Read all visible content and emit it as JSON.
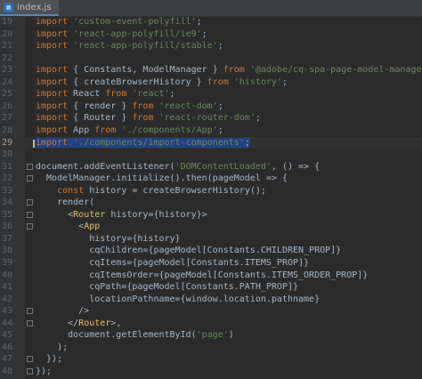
{
  "tab": {
    "filename": "index.js",
    "icon": "js-file-icon"
  },
  "colors": {
    "background": "#2b2b2b",
    "keyword": "#cc7832",
    "string": "#6a8759",
    "tag": "#e8bf6a",
    "text": "#a9b7c6",
    "selection": "#214283"
  },
  "lines": [
    {
      "num": "19",
      "tokens": [
        {
          "t": "import ",
          "c": "kw"
        },
        {
          "t": "'custom-event-polyfill'",
          "c": "str"
        },
        {
          "t": ";",
          "c": "plain"
        }
      ]
    },
    {
      "num": "20",
      "tokens": [
        {
          "t": "import ",
          "c": "kw"
        },
        {
          "t": "'react-app-polyfill/ie9'",
          "c": "str"
        },
        {
          "t": ";",
          "c": "plain"
        }
      ]
    },
    {
      "num": "21",
      "tokens": [
        {
          "t": "import ",
          "c": "kw"
        },
        {
          "t": "'react-app-polyfill/stable'",
          "c": "str"
        },
        {
          "t": ";",
          "c": "plain"
        }
      ]
    },
    {
      "num": "22",
      "tokens": []
    },
    {
      "num": "23",
      "tokens": [
        {
          "t": "import ",
          "c": "kw"
        },
        {
          "t": "{ Constants, ModelManager } ",
          "c": "plain"
        },
        {
          "t": "from ",
          "c": "kw"
        },
        {
          "t": "'@adobe/cq-spa-page-model-manager'",
          "c": "str"
        },
        {
          "t": ";",
          "c": "plain"
        }
      ]
    },
    {
      "num": "24",
      "tokens": [
        {
          "t": "import ",
          "c": "kw"
        },
        {
          "t": "{ createBrowserHistory } ",
          "c": "plain"
        },
        {
          "t": "from ",
          "c": "kw"
        },
        {
          "t": "'history'",
          "c": "str"
        },
        {
          "t": ";",
          "c": "plain"
        }
      ]
    },
    {
      "num": "25",
      "tokens": [
        {
          "t": "import ",
          "c": "kw"
        },
        {
          "t": "React ",
          "c": "plain"
        },
        {
          "t": "from ",
          "c": "kw"
        },
        {
          "t": "'react'",
          "c": "str"
        },
        {
          "t": ";",
          "c": "plain"
        }
      ]
    },
    {
      "num": "26",
      "tokens": [
        {
          "t": "import ",
          "c": "kw"
        },
        {
          "t": "{ render } ",
          "c": "plain"
        },
        {
          "t": "from ",
          "c": "kw"
        },
        {
          "t": "'react-dom'",
          "c": "str"
        },
        {
          "t": ";",
          "c": "plain"
        }
      ]
    },
    {
      "num": "27",
      "tokens": [
        {
          "t": "import ",
          "c": "kw"
        },
        {
          "t": "{ Router } ",
          "c": "plain"
        },
        {
          "t": "from ",
          "c": "kw"
        },
        {
          "t": "'react-router-dom'",
          "c": "str"
        },
        {
          "t": ";",
          "c": "plain"
        }
      ]
    },
    {
      "num": "28",
      "tokens": [
        {
          "t": "import ",
          "c": "kw"
        },
        {
          "t": "App ",
          "c": "plain"
        },
        {
          "t": "from ",
          "c": "kw"
        },
        {
          "t": "'./components/App'",
          "c": "str"
        },
        {
          "t": ";",
          "c": "plain"
        }
      ]
    },
    {
      "num": "29",
      "current": true,
      "tokens": [
        {
          "t": "import ",
          "c": "kw",
          "sel": true
        },
        {
          "t": "'./components/import-components'",
          "c": "str",
          "sel": true
        },
        {
          "t": ";",
          "c": "plain",
          "sel": true
        }
      ]
    },
    {
      "num": "30",
      "tokens": []
    },
    {
      "num": "31",
      "tokens": [
        {
          "t": "document.addEventListener(",
          "c": "plain"
        },
        {
          "t": "'DOMContentLoaded'",
          "c": "str"
        },
        {
          "t": ", () => {",
          "c": "plain"
        }
      ]
    },
    {
      "num": "32",
      "tokens": [
        {
          "t": "  ModelManager.initialize().then(pageModel => {",
          "c": "plain"
        }
      ]
    },
    {
      "num": "33",
      "tokens": [
        {
          "t": "    ",
          "c": "plain"
        },
        {
          "t": "const ",
          "c": "kw"
        },
        {
          "t": "history = createBrowserHistory();",
          "c": "plain"
        }
      ]
    },
    {
      "num": "34",
      "tokens": [
        {
          "t": "    render(",
          "c": "plain"
        }
      ]
    },
    {
      "num": "35",
      "tokens": [
        {
          "t": "      <",
          "c": "plain"
        },
        {
          "t": "Router ",
          "c": "tag"
        },
        {
          "t": "history={history}>",
          "c": "plain"
        }
      ]
    },
    {
      "num": "36",
      "tokens": [
        {
          "t": "        <",
          "c": "plain"
        },
        {
          "t": "App",
          "c": "tag"
        }
      ]
    },
    {
      "num": "37",
      "tokens": [
        {
          "t": "          history={history}",
          "c": "plain"
        }
      ]
    },
    {
      "num": "38",
      "tokens": [
        {
          "t": "          cqChildren={pageModel[Constants.CHILDREN_PROP]}",
          "c": "plain"
        }
      ]
    },
    {
      "num": "39",
      "tokens": [
        {
          "t": "          cqItems={pageModel[Constants.ITEMS_PROP]}",
          "c": "plain"
        }
      ]
    },
    {
      "num": "40",
      "tokens": [
        {
          "t": "          cqItemsOrder={pageModel[Constants.ITEMS_ORDER_PROP]}",
          "c": "plain"
        }
      ]
    },
    {
      "num": "41",
      "tokens": [
        {
          "t": "          cqPath={pageModel[Constants.PATH_PROP]}",
          "c": "plain"
        }
      ]
    },
    {
      "num": "42",
      "tokens": [
        {
          "t": "          locationPathname={window.location.pathname}",
          "c": "plain"
        }
      ]
    },
    {
      "num": "43",
      "tokens": [
        {
          "t": "        />",
          "c": "plain"
        }
      ]
    },
    {
      "num": "44",
      "tokens": [
        {
          "t": "      </",
          "c": "plain"
        },
        {
          "t": "Router",
          "c": "tag"
        },
        {
          "t": ">,",
          "c": "plain"
        }
      ]
    },
    {
      "num": "45",
      "tokens": [
        {
          "t": "      document.getElementById(",
          "c": "plain"
        },
        {
          "t": "'page'",
          "c": "str"
        },
        {
          "t": ")",
          "c": "plain"
        }
      ]
    },
    {
      "num": "46",
      "tokens": [
        {
          "t": "    );",
          "c": "plain"
        }
      ]
    },
    {
      "num": "47",
      "tokens": [
        {
          "t": "  });",
          "c": "plain"
        }
      ]
    },
    {
      "num": "48",
      "tokens": [
        {
          "t": "});",
          "c": "plain"
        }
      ]
    }
  ]
}
